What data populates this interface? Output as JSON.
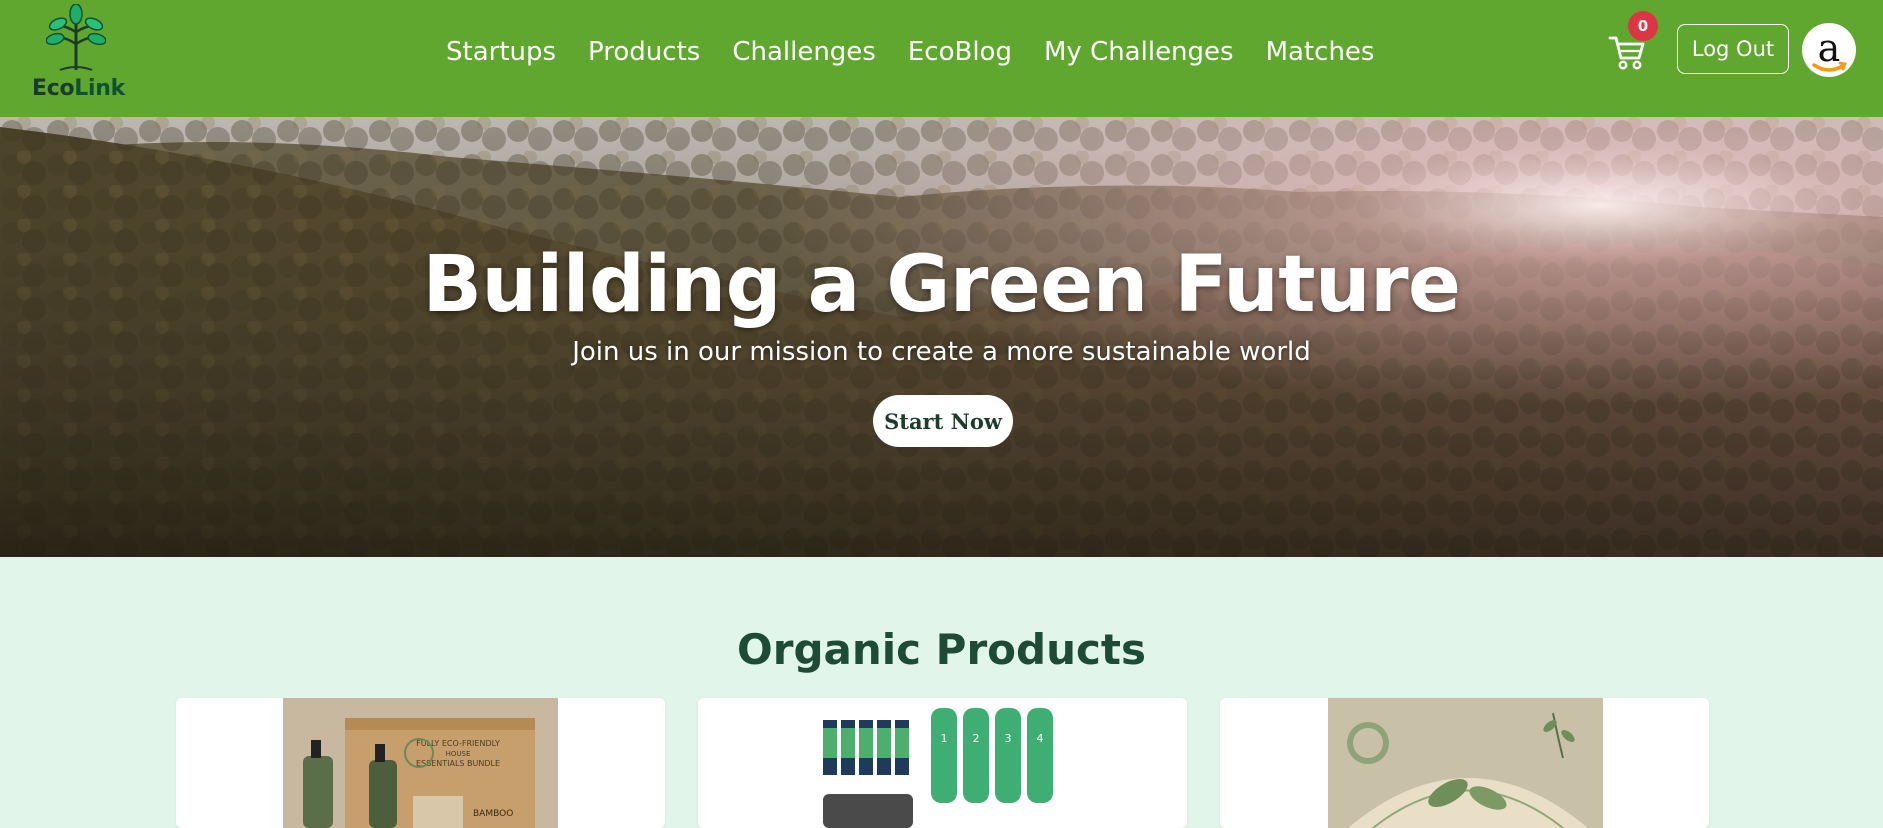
{
  "brand": {
    "name_part1": "Eco",
    "name_part2": "Link"
  },
  "nav": {
    "links": [
      "Startups",
      "Products",
      "Challenges",
      "EcoBlog",
      "My Challenges",
      "Matches"
    ]
  },
  "cart": {
    "count": "0"
  },
  "account": {
    "logout_label": "Log Out",
    "avatar_glyph": "a"
  },
  "hero": {
    "title": "Building a Green Future",
    "subtitle": "Join us in our mission to create a more sustainable world",
    "cta_label": "Start Now"
  },
  "products": {
    "section_title": "Organic Products",
    "cards": [
      {
        "thumb_text_1": "FULLY ECO-FRIENDLY",
        "thumb_text_2": "HOUSE",
        "thumb_text_3": "ESSENTIALS BUNDLE",
        "thumb_text_4": "BAMBOO"
      },
      {
        "thumb_labels": [
          "1",
          "2",
          "3",
          "4"
        ]
      },
      {}
    ]
  },
  "colors": {
    "navbar": "#5fa72f",
    "page_bg": "#e1f5ea",
    "section_title": "#1d4b36",
    "badge": "#dc3545"
  }
}
